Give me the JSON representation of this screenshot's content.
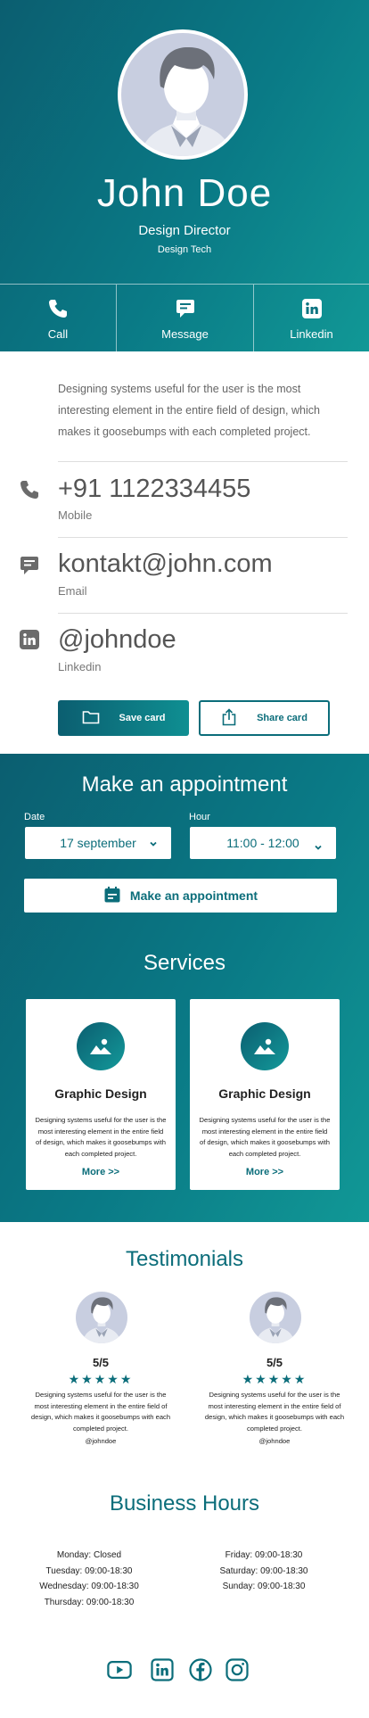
{
  "profile": {
    "name": "John Doe",
    "title": "Design Director",
    "company": "Design Tech"
  },
  "quick_actions": [
    {
      "label": "Call",
      "icon": "phone-icon"
    },
    {
      "label": "Message",
      "icon": "message-icon"
    },
    {
      "label": "Linkedin",
      "icon": "linkedin-icon"
    }
  ],
  "bio": "Designing systems useful for the user is the most interesting element in the entire field of design, which makes it goosebumps with each completed project.",
  "contacts": [
    {
      "value": "+91 1122334455",
      "label": "Mobile",
      "icon": "phone-icon"
    },
    {
      "value": "kontakt@john.com",
      "label": "Email",
      "icon": "message-icon"
    },
    {
      "value": "@johndoe",
      "label": "Linkedin",
      "icon": "linkedin-icon"
    }
  ],
  "actions": {
    "save_label": "Save card",
    "share_label": "Share card"
  },
  "appointment": {
    "heading_prefix": "Make an ",
    "heading_strong": "appointment",
    "date_label": "Date",
    "date_value": "17 september",
    "hour_label": "Hour",
    "hour_value": "11:00 - 12:00",
    "button_label": "Make an appointment"
  },
  "services": {
    "heading": "Services",
    "items": [
      {
        "title": "Graphic Design",
        "description": "Designing systems useful for the user is the most interesting element in the entire field of design, which makes it goosebumps with each completed project.",
        "more": "More >>",
        "icon": "image-icon"
      },
      {
        "title": "Graphic Design",
        "description": "Designing systems useful for the user is the most interesting element in the entire field of design, which makes it goosebumps with each completed project.",
        "more": "More >>",
        "icon": "image-icon"
      }
    ]
  },
  "testimonials": {
    "heading": "Testimonials",
    "items": [
      {
        "rating": "5/5",
        "stars": 5,
        "text": "Designing systems useful for the user is the most interesting element in the entire field of design, which makes it goosebumps with each completed project.",
        "handle": "@johndoe"
      },
      {
        "rating": "5/5",
        "stars": 5,
        "text": "Designing systems useful for the user is the most interesting element in the entire field of design, which makes it goosebumps with each completed project.",
        "handle": "@johndoe"
      }
    ]
  },
  "hours": {
    "heading": "Business Hours",
    "left": [
      "Monday: Closed",
      "Tuesday: 09:00-18:30",
      "Wednesday: 09:00-18:30",
      "Thursday: 09:00-18:30"
    ],
    "right": [
      "Friday: 09:00-18:30",
      "Saturday: 09:00-18:30",
      "Sunday: 09:00-18:30"
    ]
  },
  "social": [
    "youtube-icon",
    "linkedin-icon",
    "facebook-icon",
    "instagram-icon"
  ],
  "colors": {
    "accent": "#0b6d7a",
    "accent_light": "#119896"
  }
}
